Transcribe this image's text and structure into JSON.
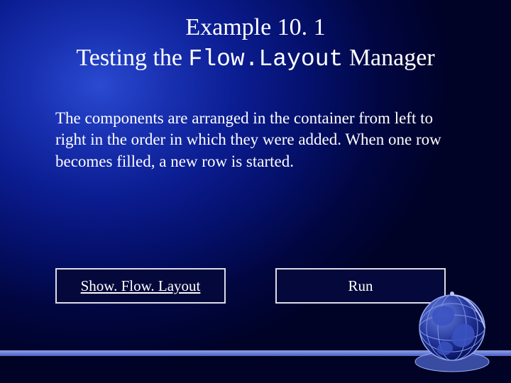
{
  "title": {
    "line1": "Example 10. 1",
    "line2_pre": "Testing the ",
    "line2_code": "Flow.Layout",
    "line2_post": " Manager"
  },
  "body": "The components are arranged in the container from left to right in the order in which they were added. When one row becomes filled, a new row is started.",
  "buttons": {
    "show": "Show. Flow. Layout",
    "run": "Run"
  }
}
